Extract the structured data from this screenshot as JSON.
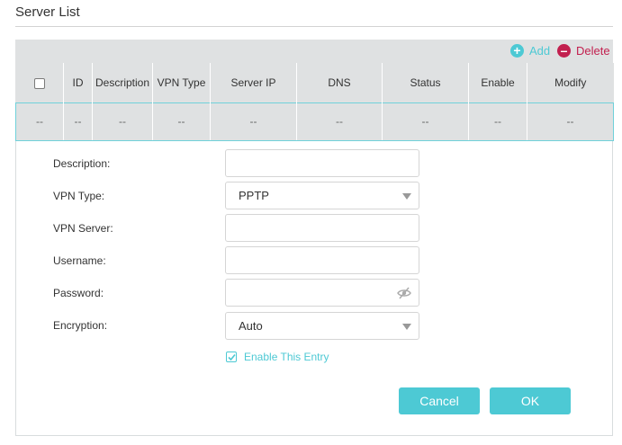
{
  "section": {
    "title": "Server List"
  },
  "toolbar": {
    "add_label": "Add",
    "delete_label": "Delete"
  },
  "table": {
    "columns": [
      "ID",
      "Description",
      "VPN Type",
      "Server IP",
      "DNS",
      "Status",
      "Enable",
      "Modify"
    ],
    "row": [
      "--",
      "--",
      "--",
      "--",
      "--",
      "--",
      "--",
      "--",
      "--"
    ]
  },
  "form": {
    "description_label": "Description:",
    "description_value": "",
    "vpn_type_label": "VPN Type:",
    "vpn_type_value": "PPTP",
    "vpn_server_label": "VPN Server:",
    "vpn_server_value": "",
    "username_label": "Username:",
    "username_value": "",
    "password_label": "Password:",
    "password_value": "",
    "encryption_label": "Encryption:",
    "encryption_value": "Auto",
    "enable_label": "Enable This Entry",
    "enable_checked": true
  },
  "buttons": {
    "cancel": "Cancel",
    "ok": "OK"
  },
  "colors": {
    "accent": "#4dc9d4",
    "delete": "#c2204f",
    "header_bg": "#dfe1e2"
  },
  "icons": {
    "add": "plus-circle-icon",
    "delete": "minus-circle-icon",
    "password": "eye-slash-icon",
    "checkbox": "checkmark-icon"
  }
}
